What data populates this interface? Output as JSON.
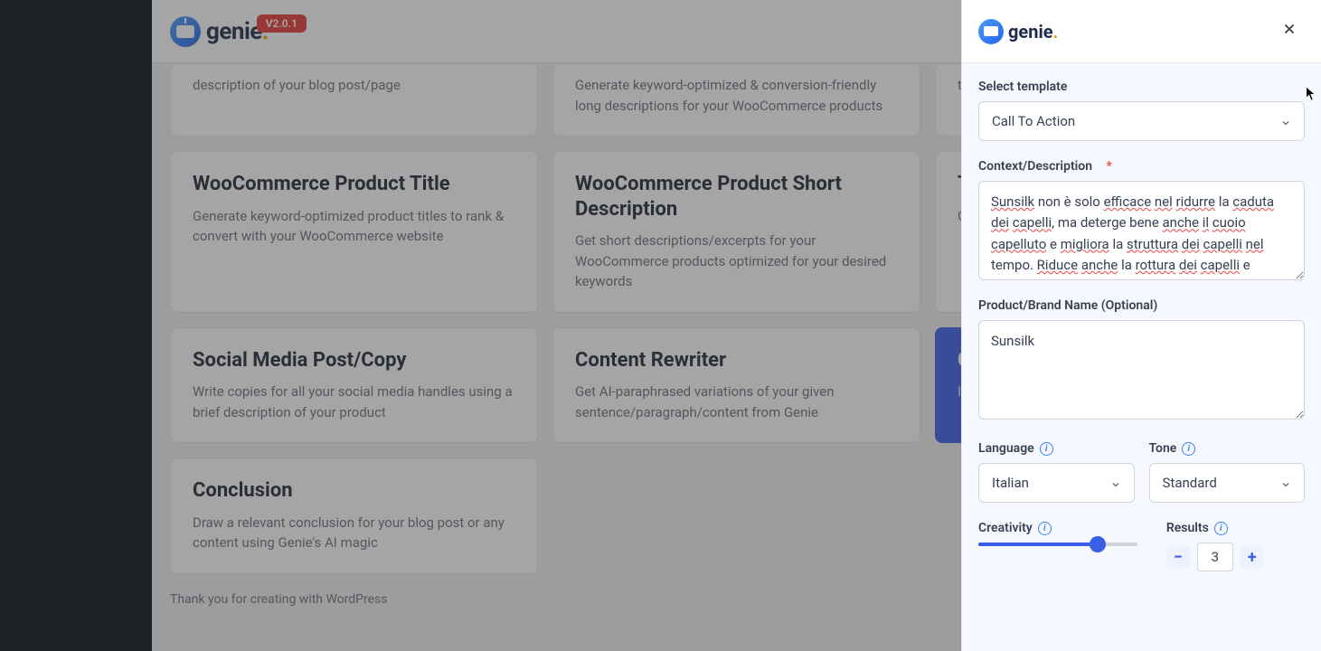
{
  "header": {
    "logo_text": "genie",
    "version": "V2.0.1"
  },
  "cards": [
    {
      "title": "",
      "desc": "description of your blog post/page"
    },
    {
      "title": "",
      "desc": "Generate keyword-optimized & conversion-friendly long descriptions for your WooCommerce products"
    },
    {
      "title": "",
      "desc": "topi..."
    },
    {
      "title": "WooCommerce Product Title",
      "desc": "Generate keyword-optimized product titles to rank & convert with your WooCommerce website"
    },
    {
      "title": "WooCommerce Product Short Description",
      "desc": "Get short descriptions/excerpts for your WooCommerce products optimized for your desired keywords"
    },
    {
      "title": "Tag",
      "desc": "Get prod..."
    },
    {
      "title": "Social Media Post/Copy",
      "desc": "Write copies for all your social media handles using a brief description of your product"
    },
    {
      "title": "Content Rewriter",
      "desc": "Get AI-paraphrased variations of your given sentence/paragraph/content from Genie"
    },
    {
      "title": "Ca",
      "desc": "Incre mag",
      "active": true
    },
    {
      "title": "Conclusion",
      "desc": "Draw a relevant conclusion for your blog post or any content using Genie's AI magic"
    }
  ],
  "footer": "Thank you for creating with WordPress",
  "panel": {
    "logo_text": "genie",
    "template_label": "Select template",
    "template_value": "Call To Action",
    "context_label": "Context/Description",
    "context_value": "Sunsilk non è solo efficace nel ridurre la caduta dei capelli, ma deterge bene anche il cuoio capelluto e migliora la struttura dei capelli nel tempo. Riduce anche la rottura dei capelli e",
    "brand_label": "Product/Brand Name (Optional)",
    "brand_value": "Sunsilk",
    "language_label": "Language",
    "language_value": "Italian",
    "tone_label": "Tone",
    "tone_value": "Standard",
    "creativity_label": "Creativity",
    "results_label": "Results",
    "results_value": "3"
  }
}
